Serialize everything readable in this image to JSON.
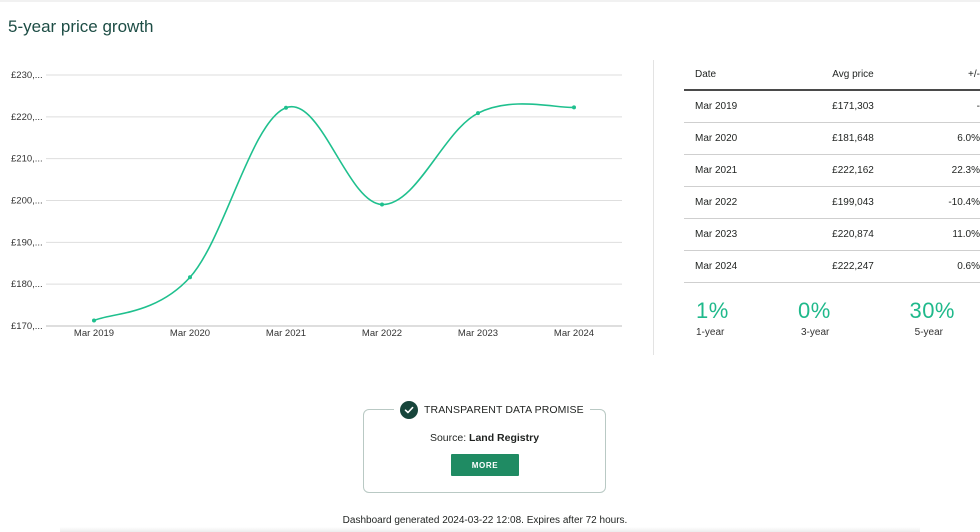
{
  "page": {
    "title": "5-year price growth"
  },
  "chart_data": {
    "type": "line",
    "categories": [
      "Mar 2019",
      "Mar 2020",
      "Mar 2021",
      "Mar 2022",
      "Mar 2023",
      "Mar 2024"
    ],
    "series": [
      {
        "values": [
          171303,
          181648,
          222162,
          199043,
          220874,
          222247
        ]
      }
    ],
    "y_ticks": [
      "£230,...",
      "£220,...",
      "£210,...",
      "£200,...",
      "£190,...",
      "£180,...",
      "£170,..."
    ],
    "ylim": [
      170000,
      230000
    ],
    "grid": true,
    "color": "#1fc08e"
  },
  "table": {
    "headers": {
      "date": "Date",
      "avg": "Avg price",
      "change": "+/-"
    },
    "rows": [
      {
        "date": "Mar 2019",
        "avg": "£171,303",
        "change": "-"
      },
      {
        "date": "Mar 2020",
        "avg": "£181,648",
        "change": "6.0%"
      },
      {
        "date": "Mar 2021",
        "avg": "£222,162",
        "change": "22.3%"
      },
      {
        "date": "Mar 2022",
        "avg": "£199,043",
        "change": "-10.4%"
      },
      {
        "date": "Mar 2023",
        "avg": "£220,874",
        "change": "11.0%"
      },
      {
        "date": "Mar 2024",
        "avg": "£222,247",
        "change": "0.6%"
      }
    ]
  },
  "growth": [
    {
      "value": "1%",
      "label": "1-year"
    },
    {
      "value": "0%",
      "label": "3-year"
    },
    {
      "value": "30%",
      "label": "5-year"
    }
  ],
  "promise": {
    "title": "TRANSPARENT DATA PROMISE",
    "source_prefix": "Source:",
    "source_name": "Land Registry",
    "button": "MORE"
  },
  "footer": "Dashboard generated 2024-03-22 12:08. Expires after 72 hours.",
  "colors": {
    "accent": "#1fb98b",
    "dark": "#17453b",
    "button": "#1f8b63"
  }
}
